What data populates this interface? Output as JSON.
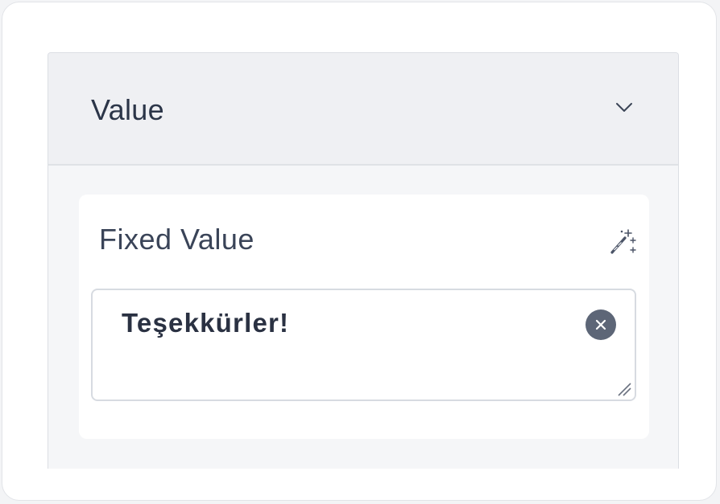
{
  "section": {
    "title": "Value",
    "collapse_icon": "chevron-down-icon"
  },
  "field": {
    "label": "Fixed Value",
    "action_icon": "magic-wand-icon",
    "value": "Teşekkürler!",
    "clear_icon": "clear-icon"
  },
  "colors": {
    "header_bg": "#eff0f3",
    "clear_button_bg": "#5d6677",
    "text_dark": "#2a3142"
  }
}
